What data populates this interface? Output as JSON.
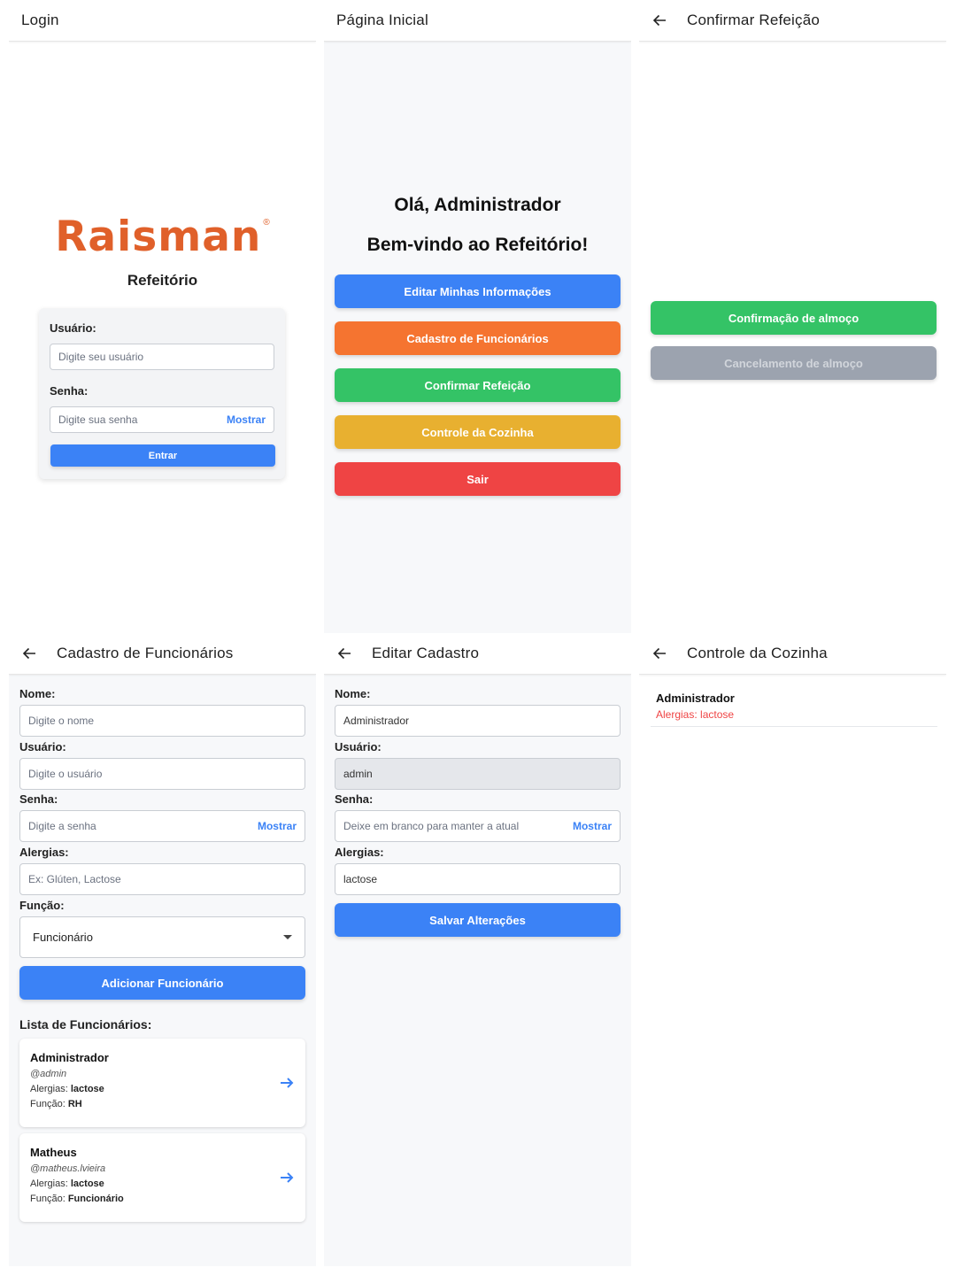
{
  "colors": {
    "blue": "#3b82f6",
    "orange": "#f57430",
    "green": "#34c366",
    "yellow": "#e8b030",
    "red": "#ef4444",
    "gray": "#9ca3af",
    "brand": "#e0602a"
  },
  "login": {
    "title": "Login",
    "logo": "Raisman",
    "logo_mark": "®",
    "subtitle": "Refeitório",
    "user_label": "Usuário:",
    "user_placeholder": "Digite seu usuário",
    "pass_label": "Senha:",
    "pass_placeholder": "Digite sua senha",
    "show_label": "Mostrar",
    "submit_label": "Entrar"
  },
  "home": {
    "title": "Página Inicial",
    "greeting": "Olá, Administrador",
    "welcome": "Bem-vindo ao Refeitório!",
    "buttons": [
      {
        "label": "Editar Minhas Informações"
      },
      {
        "label": "Cadastro de Funcionários"
      },
      {
        "label": "Confirmar Refeição"
      },
      {
        "label": "Controle da Cozinha"
      },
      {
        "label": "Sair"
      }
    ]
  },
  "confirm": {
    "title": "Confirmar Refeição",
    "confirm_label": "Confirmação de almoço",
    "cancel_label": "Cancelamento de almoço"
  },
  "cadastro": {
    "title": "Cadastro de Funcionários",
    "name_label": "Nome:",
    "name_placeholder": "Digite o nome",
    "user_label": "Usuário:",
    "user_placeholder": "Digite o usuário",
    "pass_label": "Senha:",
    "pass_placeholder": "Digite a senha",
    "show_label": "Mostrar",
    "allergy_label": "Alergias:",
    "allergy_placeholder": "Ex: Glúten, Lactose",
    "role_label": "Função:",
    "role_value": "Funcionário",
    "add_label": "Adicionar Funcionário",
    "list_title": "Lista de Funcionários:",
    "allergy_prefix": "Alergias:",
    "role_prefix": "Função:",
    "employees": [
      {
        "name": "Administrador",
        "username": "@admin",
        "allergies": "lactose",
        "role": "RH"
      },
      {
        "name": "Matheus",
        "username": "@matheus.lvieira",
        "allergies": "lactose",
        "role": "Funcionário"
      }
    ]
  },
  "edit": {
    "title": "Editar Cadastro",
    "name_label": "Nome:",
    "name_value": "Administrador",
    "user_label": "Usuário:",
    "user_value": "admin",
    "pass_label": "Senha:",
    "pass_placeholder": "Deixe em branco para manter a atual",
    "show_label": "Mostrar",
    "allergy_label": "Alergias:",
    "allergy_value": "lactose",
    "save_label": "Salvar Alterações"
  },
  "kitchen": {
    "title": "Controle da Cozinha",
    "items": [
      {
        "name": "Administrador",
        "allergy": "Alergias: lactose"
      }
    ]
  }
}
